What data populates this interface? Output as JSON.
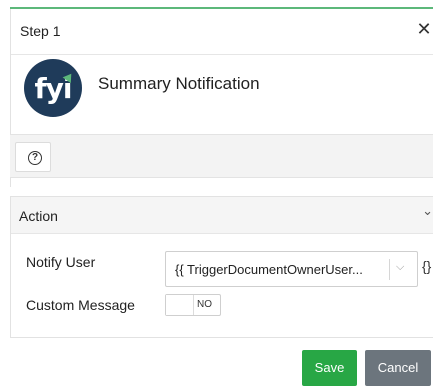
{
  "dialog": {
    "step_title": "Step 1",
    "close_glyph": "✕",
    "app_logo_text": "fyi",
    "app_title": "Summary Notification",
    "help_glyph": "?"
  },
  "action": {
    "title": "Action",
    "collapse_glyph": "⌄",
    "notify_user": {
      "label": "Notify User",
      "value": "{{ TriggerDocumentOwnerUser...",
      "chevron_glyph": "⌵",
      "braces_glyph": "{}"
    },
    "custom_message": {
      "label": "Custom Message",
      "toggle_state": "NO"
    }
  },
  "footer": {
    "save_label": "Save",
    "cancel_label": "Cancel"
  },
  "colors": {
    "accent": "#5cb87a",
    "logo_bg": "#1f3b5a",
    "save": "#28a745",
    "cancel": "#6c757d"
  },
  "icons": {
    "close": "close-icon",
    "help": "help-circle-icon",
    "collapse": "chevron-down-icon",
    "select": "chevron-down-icon",
    "variables": "braces-icon"
  }
}
